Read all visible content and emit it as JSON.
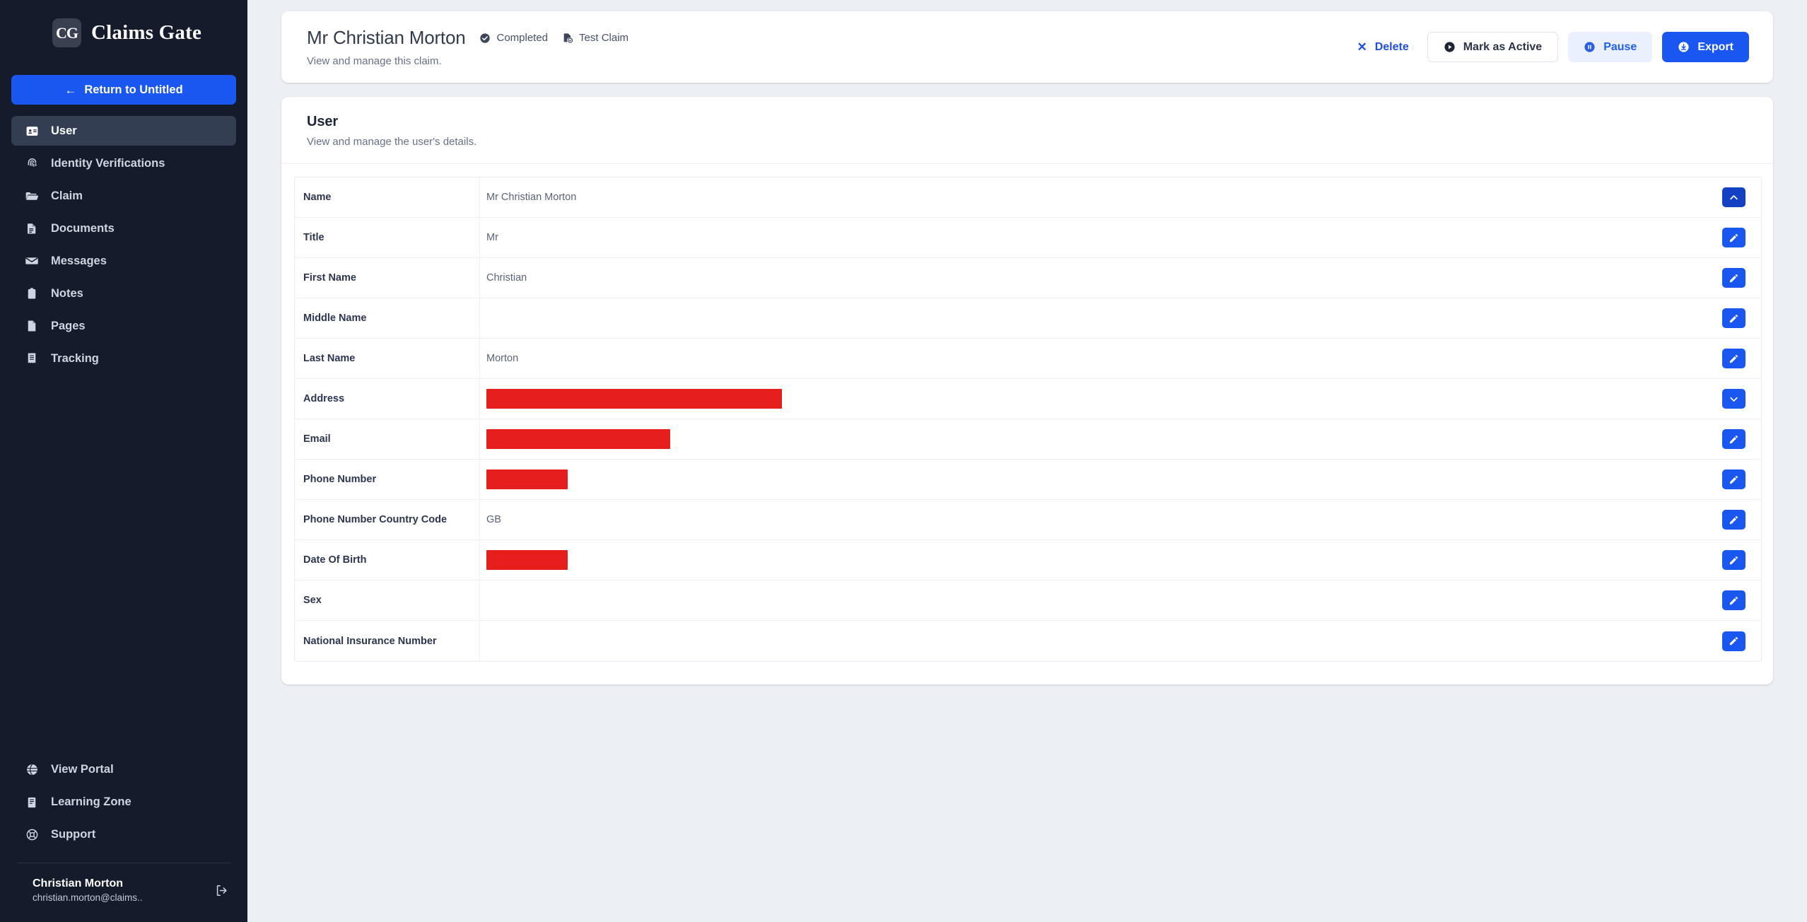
{
  "sidebar": {
    "brand": {
      "mark": "CG",
      "name": "Claims Gate"
    },
    "return_button": {
      "label": "Return to Untitled",
      "arrow": "←"
    },
    "items": [
      {
        "label": "User",
        "icon": "id-card-icon",
        "active": true
      },
      {
        "label": "Identity Verifications",
        "icon": "fingerprint-icon",
        "active": false
      },
      {
        "label": "Claim",
        "icon": "folder-icon",
        "active": false
      },
      {
        "label": "Documents",
        "icon": "document-icon",
        "active": false
      },
      {
        "label": "Messages",
        "icon": "envelope-icon",
        "active": false
      },
      {
        "label": "Notes",
        "icon": "clipboard-icon",
        "active": false
      },
      {
        "label": "Pages",
        "icon": "page-icon",
        "active": false
      },
      {
        "label": "Tracking",
        "icon": "receipt-icon",
        "active": false
      }
    ],
    "bottom_items": [
      {
        "label": "View Portal",
        "icon": "globe-icon"
      },
      {
        "label": "Learning Zone",
        "icon": "book-icon"
      },
      {
        "label": "Support",
        "icon": "lifebuoy-icon"
      }
    ],
    "profile": {
      "name": "Christian Morton",
      "email": "christian.morton@claims..",
      "logout_icon": "logout-icon"
    }
  },
  "header": {
    "title": "Mr Christian Morton",
    "subtitle": "View and manage this claim.",
    "badges": [
      {
        "label": "Completed",
        "icon": "check-circle-icon"
      },
      {
        "label": "Test Claim",
        "icon": "file-check-icon"
      }
    ],
    "actions": {
      "delete": {
        "label": "Delete",
        "icon": "close-icon"
      },
      "mark_active": {
        "label": "Mark as Active",
        "icon": "play-circle-icon"
      },
      "pause": {
        "label": "Pause",
        "icon": "pause-circle-icon"
      },
      "export": {
        "label": "Export",
        "icon": "download-circle-icon"
      }
    }
  },
  "user_card": {
    "title": "User",
    "subtitle": "View and manage the user's details.",
    "rows": [
      {
        "label": "Name",
        "value": "Mr Christian Morton",
        "redacted": false,
        "redact_width": 0,
        "action_icon": "chevron-up-icon",
        "action_variant": "dark"
      },
      {
        "label": "Title",
        "value": "Mr",
        "redacted": false,
        "redact_width": 0,
        "action_icon": "edit-icon",
        "action_variant": "normal"
      },
      {
        "label": "First Name",
        "value": "Christian",
        "redacted": false,
        "redact_width": 0,
        "action_icon": "edit-icon",
        "action_variant": "normal"
      },
      {
        "label": "Middle Name",
        "value": "",
        "redacted": false,
        "redact_width": 0,
        "action_icon": "edit-icon",
        "action_variant": "normal"
      },
      {
        "label": "Last Name",
        "value": "Morton",
        "redacted": false,
        "redact_width": 0,
        "action_icon": "edit-icon",
        "action_variant": "normal"
      },
      {
        "label": "Address",
        "value": "",
        "redacted": true,
        "redact_width": 418,
        "action_icon": "chevron-down-icon",
        "action_variant": "normal"
      },
      {
        "label": "Email",
        "value": "",
        "redacted": true,
        "redact_width": 260,
        "action_icon": "edit-icon",
        "action_variant": "normal"
      },
      {
        "label": "Phone Number",
        "value": "",
        "redacted": true,
        "redact_width": 115,
        "action_icon": "edit-icon",
        "action_variant": "normal"
      },
      {
        "label": "Phone Number Country Code",
        "value": "GB",
        "redacted": false,
        "redact_width": 0,
        "action_icon": "edit-icon",
        "action_variant": "normal"
      },
      {
        "label": "Date Of Birth",
        "value": "",
        "redacted": true,
        "redact_width": 115,
        "action_icon": "edit-icon",
        "action_variant": "normal"
      },
      {
        "label": "Sex",
        "value": "",
        "redacted": false,
        "redact_width": 0,
        "action_icon": "edit-icon",
        "action_variant": "normal"
      },
      {
        "label": "National Insurance Number",
        "value": "",
        "redacted": false,
        "redact_width": 0,
        "action_icon": "edit-icon",
        "action_variant": "normal"
      }
    ]
  },
  "colors": {
    "sidebar_bg": "#141b2b",
    "sidebar_active": "#333e52",
    "primary": "#1a56f0",
    "primary_dark": "#1440c4",
    "soft_blue": "#eaf0fe",
    "redaction": "#e61e1e",
    "page_bg": "#eceff4"
  }
}
